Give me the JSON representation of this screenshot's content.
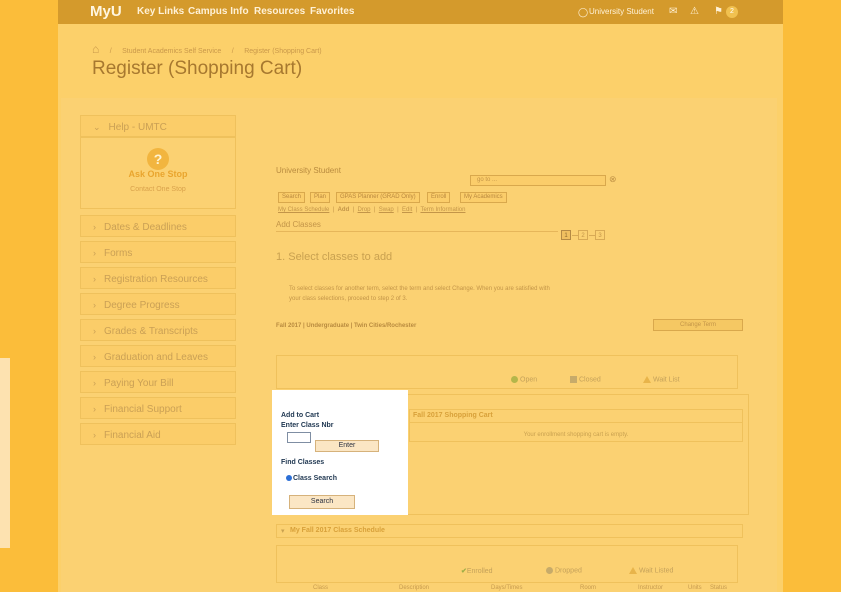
{
  "topbar": {
    "logo": "MyU",
    "links": [
      "Key Links",
      "Campus Info",
      "Resources",
      "Favorites"
    ],
    "user": "University Student",
    "notifications_count": "2"
  },
  "breadcrumb": {
    "items": [
      "Student Academics Self Service",
      "Register (Shopping Cart)"
    ]
  },
  "page_title": "Register (Shopping Cart)",
  "sidebar": {
    "help_header": "Help - UMTC",
    "ask_one_stop": "Ask One Stop",
    "contact_one_stop": "Contact One Stop",
    "items": [
      "Dates & Deadlines",
      "Forms",
      "Registration Resources",
      "Degree Progress",
      "Grades & Transcripts",
      "Graduation and Leaves",
      "Paying Your Bill",
      "Financial Support",
      "Financial Aid"
    ]
  },
  "content": {
    "student_name": "University Student",
    "goto_placeholder": "go to ...",
    "tabs": [
      "Search",
      "Plan",
      "GPAS Planner (GRAD Only)",
      "Enroll",
      "My Academics"
    ],
    "subtabs": [
      "My Class Schedule",
      "Add",
      "Drop",
      "Swap",
      "Edit",
      "Term Information"
    ],
    "add_classes": "Add Classes",
    "steps": [
      "1",
      "2",
      "3"
    ],
    "step_heading": "1.  Select classes to add",
    "instructions_line1": "To select classes for another term, select the term and select Change.  When you are satisfied with",
    "instructions_line2": "your class selections, proceed to step 2 of 3.",
    "term": "Fall 2017 | Undergraduate | Twin Cities/Rochester",
    "change_term": "Change Term",
    "legend": {
      "open": "Open",
      "closed": "Closed",
      "wait": "Wait List"
    },
    "shopping_cart_title": "Fall 2017 Shopping Cart",
    "cart_empty": "Your enrollment shopping cart is empty.",
    "schedule_title": "My Fall 2017 Class Schedule",
    "schedule_legend": {
      "enrolled": "Enrolled",
      "dropped": "Dropped",
      "waitlisted": "Wait Listed"
    },
    "schedule_columns": [
      "Class",
      "Description",
      "Days/Times",
      "Room",
      "Instructor",
      "Units",
      "Status"
    ]
  },
  "add_cart": {
    "title": "Add to Cart",
    "class_nbr_label": "Enter Class Nbr",
    "enter_button": "Enter",
    "find_classes": "Find Classes",
    "class_search_label": "Class Search",
    "search_button": "Search"
  },
  "colors": {
    "frame": "#fbbd3a",
    "overlay": "#fcd06a",
    "topbar": "#d49a2c",
    "highlight_box": "#ffffff"
  }
}
